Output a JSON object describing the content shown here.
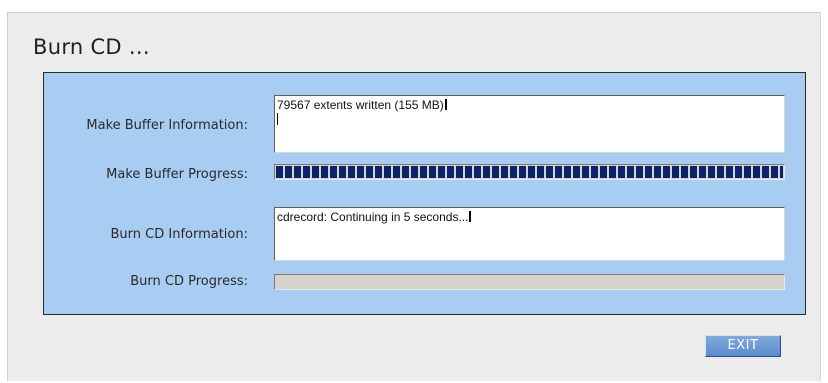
{
  "window": {
    "title": "Burn CD ..."
  },
  "make_buffer": {
    "info_label": "Make Buffer Information:",
    "info_text": "79567 extents written (155 MB)",
    "progress_label": "Make Buffer Progress:",
    "progress_percent": 100
  },
  "burn_cd": {
    "info_label": "Burn CD Information:",
    "info_text": "cdrecord: Continuing in 5 seconds...",
    "progress_label": "Burn CD Progress:",
    "progress_percent": 0
  },
  "buttons": {
    "exit_label": "EXIT"
  },
  "colors": {
    "panel_bg": "#a9cdf2",
    "progress_fill": "#0a246a",
    "exit_button": "#6a98d4"
  }
}
